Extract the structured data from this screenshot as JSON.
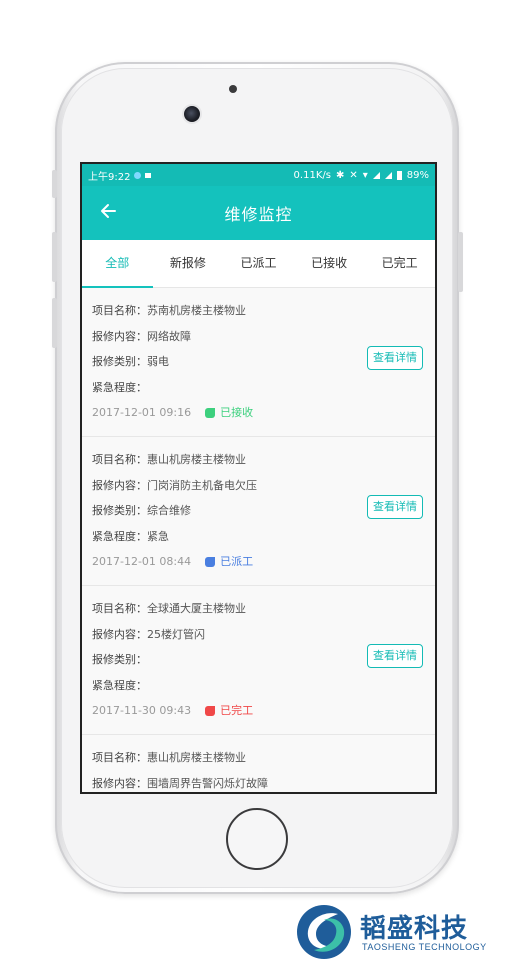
{
  "statusbar": {
    "time": "上午9:22",
    "speed": "0.11K/s",
    "battery": "89%"
  },
  "header": {
    "back_icon": "arrow-left-icon",
    "title": "维修监控"
  },
  "tabs": [
    {
      "label": "全部",
      "active": true
    },
    {
      "label": "新报修",
      "active": false
    },
    {
      "label": "已派工",
      "active": false
    },
    {
      "label": "已接收",
      "active": false
    },
    {
      "label": "已完工",
      "active": false
    }
  ],
  "labels": {
    "project": "项目名称：",
    "content": "报修内容：",
    "category": "报修类别：",
    "urgency": "紧急程度："
  },
  "detail_button_label": "查看详情",
  "orders": [
    {
      "project": "苏南机房楼主楼物业",
      "content": "网络故障",
      "category": "弱电",
      "urgency": "",
      "time": "2017-12-01 09:16",
      "status": "已接收",
      "status_color": "#3dd07e"
    },
    {
      "project": "惠山机房楼主楼物业",
      "content": "门岗消防主机备电欠压",
      "category": "综合维修",
      "urgency": "紧急",
      "time": "2017-12-01 08:44",
      "status": "已派工",
      "status_color": "#4a7fe0"
    },
    {
      "project": "全球通大厦主楼物业",
      "content": "25楼灯管闪",
      "category": "",
      "urgency": "",
      "time": "2017-11-30 09:43",
      "status": "已完工",
      "status_color": "#f04848"
    },
    {
      "project": "惠山机房楼主楼物业",
      "content": "围墙周界告警闪烁灯故障"
    }
  ],
  "logo": {
    "name_cn": "韬盛科技",
    "name_en": "TAOSHENG TECHNOLOGY"
  },
  "colors": {
    "primary": "#14c2bd",
    "brand": "#1f5d9a"
  }
}
